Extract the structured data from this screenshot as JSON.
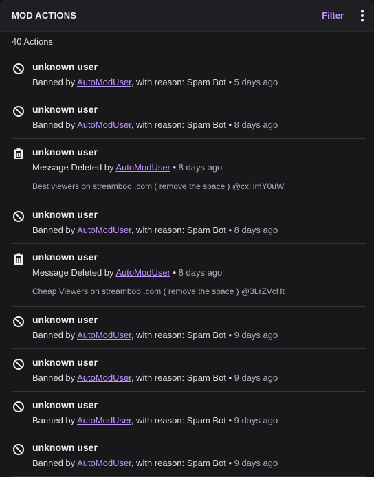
{
  "header": {
    "title": "MOD ACTIONS",
    "filter_label": "Filter",
    "more_icon": "more-vertical-icon"
  },
  "count_label": "40 Actions",
  "icons": {
    "ban": "ban-icon",
    "delete": "trash-icon"
  },
  "colors": {
    "accent": "#bf94ff",
    "panel": "#18181b",
    "header": "#1f1f23"
  },
  "actions": [
    {
      "type": "ban",
      "user": "unknown user",
      "prefix": "Banned by ",
      "moderator": "AutoModUser",
      "suffix": ", with reason: Spam Bot",
      "separator": " • ",
      "time": "5 days ago"
    },
    {
      "type": "ban",
      "user": "unknown user",
      "prefix": "Banned by ",
      "moderator": "AutoModUser",
      "suffix": ", with reason: Spam Bot",
      "separator": " • ",
      "time": "8 days ago"
    },
    {
      "type": "delete",
      "user": "unknown user",
      "prefix": "Message Deleted by ",
      "moderator": "AutoModUser",
      "suffix": "",
      "separator": " • ",
      "time": "8 days ago",
      "message": "Best viewers on streamboo .com ( remove the space ) @cxHmY0uW"
    },
    {
      "type": "ban",
      "user": "unknown user",
      "prefix": "Banned by ",
      "moderator": "AutoModUser",
      "suffix": ", with reason: Spam Bot",
      "separator": " • ",
      "time": "8 days ago"
    },
    {
      "type": "delete",
      "user": "unknown user",
      "prefix": "Message Deleted by ",
      "moderator": "AutoModUser",
      "suffix": "",
      "separator": " • ",
      "time": "8 days ago",
      "message": "Cheap Viewers on streamboo .com ( remove the space ) @3LrZVcHt"
    },
    {
      "type": "ban",
      "user": "unknown user",
      "prefix": "Banned by ",
      "moderator": "AutoModUser",
      "suffix": ", with reason: Spam Bot",
      "separator": " • ",
      "time": "9 days ago"
    },
    {
      "type": "ban",
      "user": "unknown user",
      "prefix": "Banned by ",
      "moderator": "AutoModUser",
      "suffix": ", with reason: Spam Bot",
      "separator": " • ",
      "time": "9 days ago"
    },
    {
      "type": "ban",
      "user": "unknown user",
      "prefix": "Banned by ",
      "moderator": "AutoModUser",
      "suffix": ", with reason: Spam Bot",
      "separator": " • ",
      "time": "9 days ago"
    },
    {
      "type": "ban",
      "user": "unknown user",
      "prefix": "Banned by ",
      "moderator": "AutoModUser",
      "suffix": ", with reason: Spam Bot",
      "separator": " • ",
      "time": "9 days ago"
    }
  ]
}
